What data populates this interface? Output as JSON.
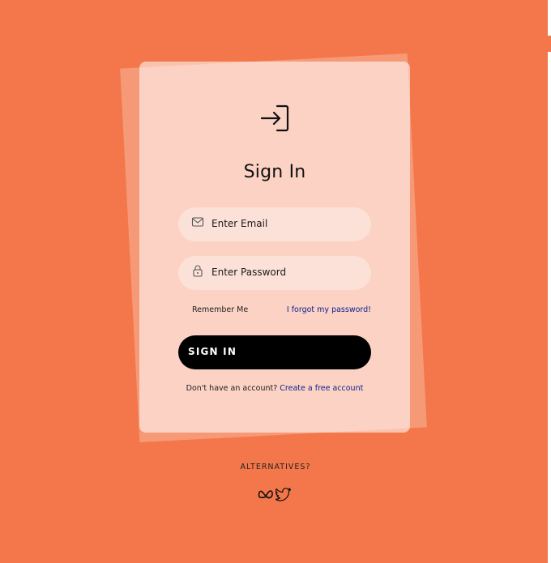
{
  "login": {
    "title": "Sign In",
    "email_placeholder": "Enter Email",
    "password_placeholder": "Enter Password",
    "remember_label": "Remember Me",
    "forgot_label": "I forgot my password!",
    "signin_label": "SIGN IN",
    "signup_prompt": "Don't have an account?",
    "signup_link": "Create a free account",
    "icons": {
      "header": "login-icon",
      "email": "mail-icon",
      "password": "lock-icon"
    }
  },
  "alternatives": {
    "label": "ALTERNATIVES?",
    "icons": [
      "meta-icon",
      "twitter-icon"
    ]
  },
  "colors": {
    "background": "#F3774A",
    "button": "#000000",
    "link": "#0A1F8F"
  }
}
